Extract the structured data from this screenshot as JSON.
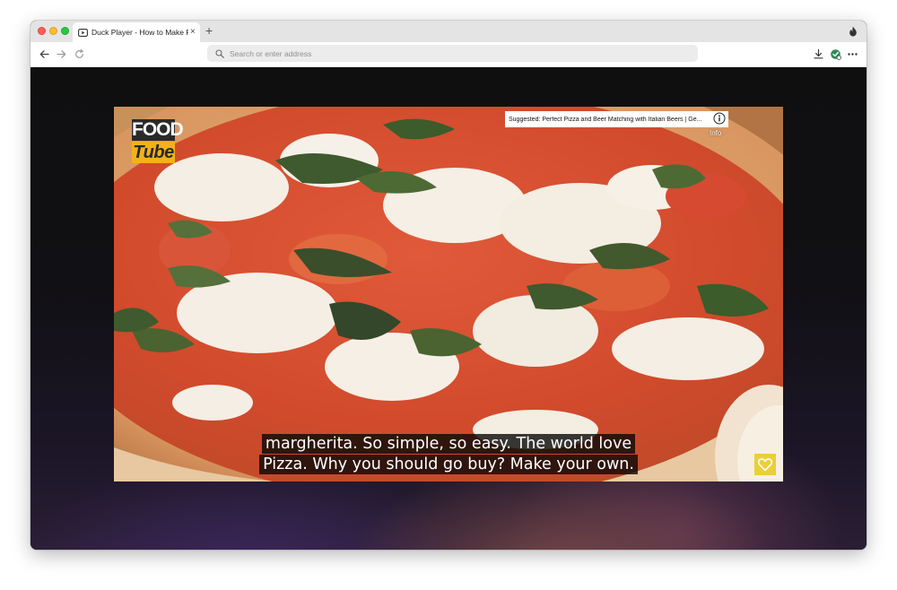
{
  "browser": {
    "tab": {
      "title": "Duck Player - How to Make Pe",
      "close": "×",
      "icon": "video-player-icon"
    },
    "new_tab": "+",
    "address": {
      "placeholder": "Search or enter address",
      "value": ""
    },
    "icons": {
      "back": "arrow-left-icon",
      "forward": "arrow-right-icon",
      "reload": "reload-icon",
      "fire": "fire-icon",
      "downloads": "download-icon",
      "extension": "extension-icon",
      "menu": "more-icon"
    }
  },
  "player": {
    "logo": {
      "line1": "FOOD",
      "line2": "Tube"
    },
    "suggested": "Suggested: Perfect Pizza and Beer Matching with Italian Beers | Ge...",
    "info_label": "Info",
    "captions": [
      "margherita. So simple, so easy. The world love",
      "Pizza. Why you should go buy? Make your own."
    ],
    "badge_icon": "heart-icon"
  },
  "colors": {
    "logo_yellow": "#f2b21b",
    "badge_yellow": "#e9cf3a",
    "tab_bar": "#e4e4e4"
  }
}
